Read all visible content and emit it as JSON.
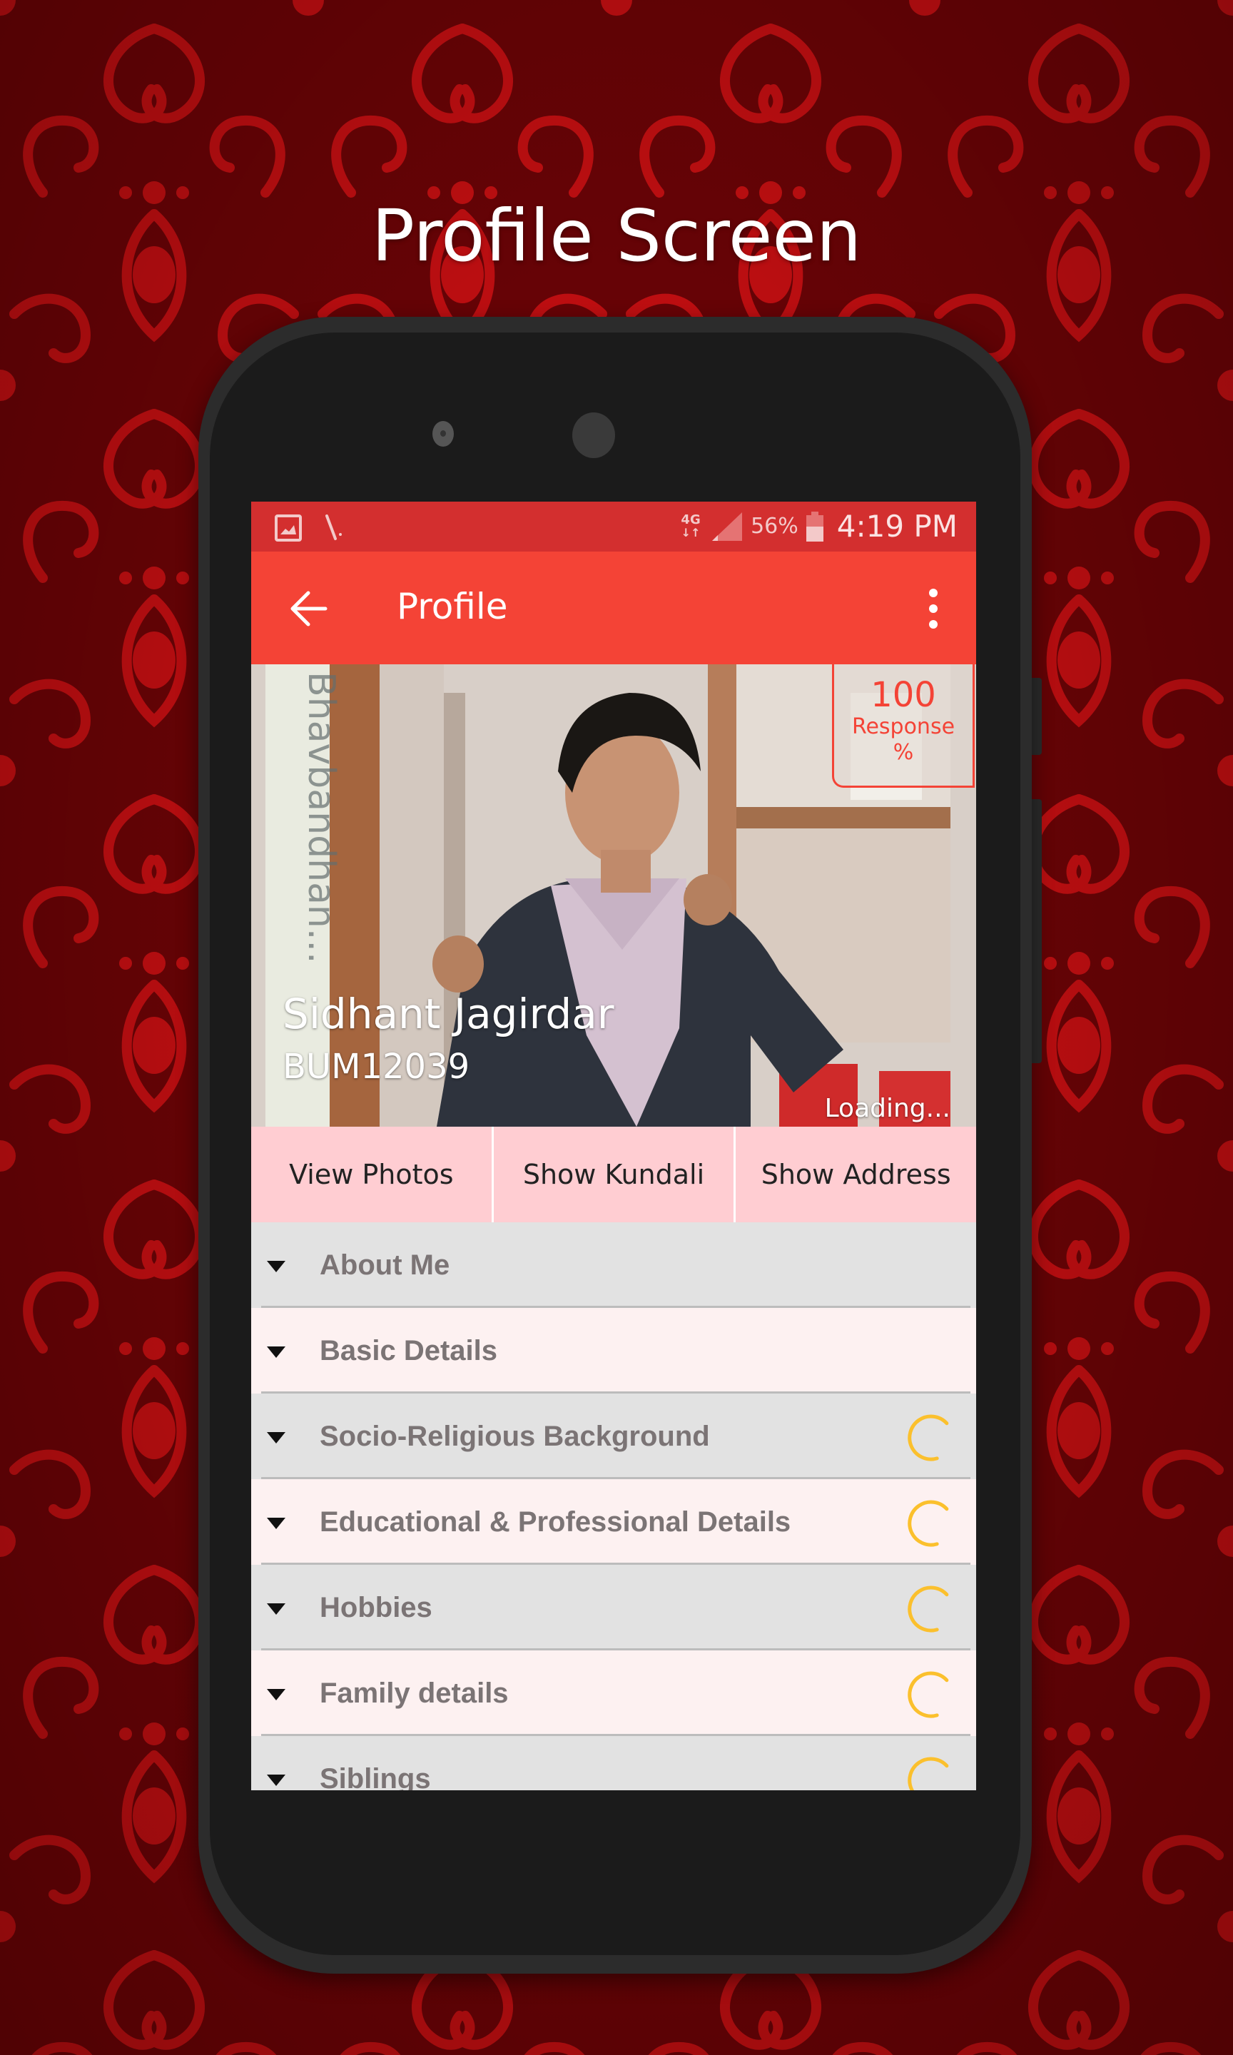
{
  "promo": {
    "title": "Profile Screen"
  },
  "colors": {
    "background": "#6a0306",
    "pattern": "#c50f12",
    "status_bar": "#d32f2f",
    "app_bar": "#f44336",
    "action_bar": "#ffcdd2",
    "row_odd": "#e2e2e2",
    "row_even": "#fdf1f1",
    "spinner": "#fbc02d"
  },
  "status_bar": {
    "left_icons": [
      "gallery-icon",
      "signal-tool-icon"
    ],
    "network": "4G",
    "network_arrows": "↓↑",
    "battery_percent": "56%",
    "time": "4:19 PM"
  },
  "app_bar": {
    "back_icon": "arrow-left-icon",
    "title": "Profile",
    "menu_icon": "more-vert-icon"
  },
  "profile": {
    "watermark": "Bhavbandhan...",
    "name": "Sidhant Jagirdar",
    "id": "BUM12039",
    "loading_text": "Loading...",
    "response": {
      "value": "100",
      "label": "Response",
      "unit": "%"
    }
  },
  "actions": [
    {
      "label": "View Photos"
    },
    {
      "label": "Show Kundali"
    },
    {
      "label": "Show Address"
    }
  ],
  "sections": [
    {
      "label": "About Me",
      "loading": false
    },
    {
      "label": "Basic Details",
      "loading": false
    },
    {
      "label": "Socio-Religious Background",
      "loading": true
    },
    {
      "label": "Educational & Professional Details",
      "loading": true
    },
    {
      "label": "Hobbies",
      "loading": true
    },
    {
      "label": "Family details",
      "loading": true
    },
    {
      "label": "Siblings",
      "loading": true
    }
  ]
}
